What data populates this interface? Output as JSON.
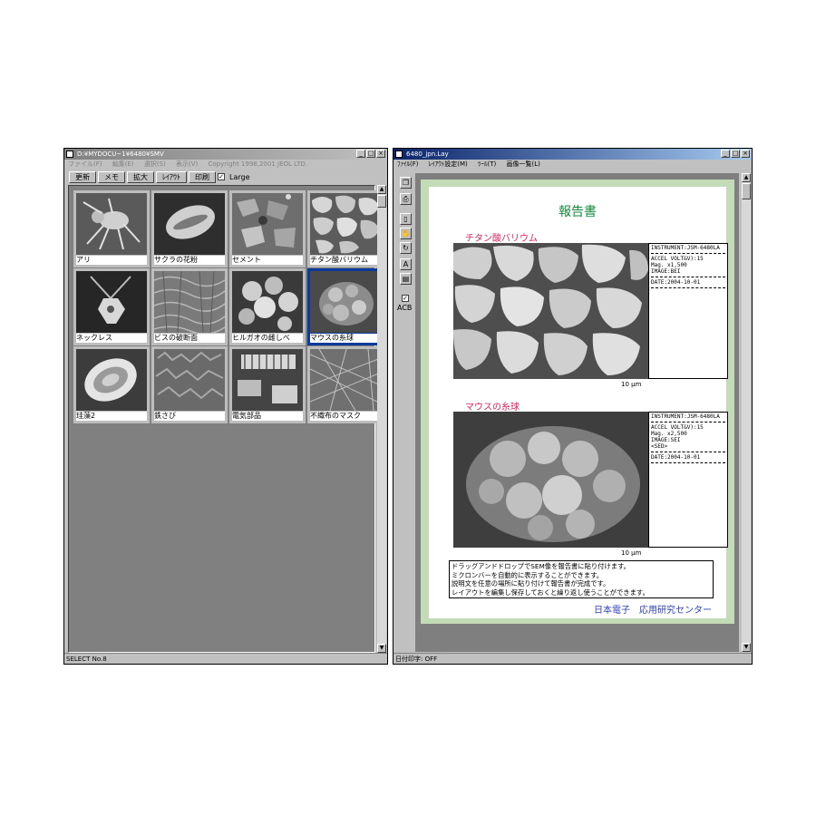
{
  "left_window": {
    "title": "D:¥MYDOCU~1¥6480¥SMV",
    "menu": [
      "ファイル(F)",
      "編集(E)",
      "選択(S)",
      "表示(V)",
      "Copyright 1998,2001 JEOL LTD."
    ],
    "toolbar": {
      "update": "更新",
      "memo": "メモ",
      "zoom": "拡大",
      "layout": "ﾚｲｱｳﾄ",
      "print": "印刷",
      "large_label": "Large",
      "large_checked": true
    },
    "thumbnails": [
      {
        "label": "アリ",
        "selected": false
      },
      {
        "label": "サクラの花粉",
        "selected": false
      },
      {
        "label": "セメント",
        "selected": false
      },
      {
        "label": "チタン酸バリウム",
        "selected": false
      },
      {
        "label": "ネックレス",
        "selected": false
      },
      {
        "label": "ビスの破断面",
        "selected": false
      },
      {
        "label": "ヒルガオの雌しべ",
        "selected": false
      },
      {
        "label": "マウスの糸球",
        "selected": true
      },
      {
        "label": "珪藻2",
        "selected": false
      },
      {
        "label": "鉄さび",
        "selected": false
      },
      {
        "label": "電気部品",
        "selected": false
      },
      {
        "label": "不織布のマスク",
        "selected": false
      }
    ],
    "status": "SELECT No.8"
  },
  "right_window": {
    "title": "6480_jpn.Lay",
    "menu": [
      "ﾌｧｲﾙ(F)",
      "ﾚｲｱｳﾄ設定(M)",
      "ﾂｰﾙ(T)",
      "画像一覧(L)"
    ],
    "tools": {
      "acb_label": "ACB",
      "text_tool": "A"
    },
    "status": "日付印字: OFF",
    "report": {
      "title": "報告書",
      "sections": [
        {
          "name": "チタン酸バリウム",
          "scale": "10 μm",
          "info": {
            "instrument": "INSTRUMENT:JSM-6480LA",
            "accel": "ACCEL VOLT&V):15",
            "mag": "Mag. x1,500",
            "image": "IMAGE:BEI",
            "date": "DATE:2004-10-01"
          }
        },
        {
          "name": "マウスの糸球",
          "scale": "10 μm",
          "info": {
            "instrument": "INSTRUMENT:JSM-6480LA",
            "accel": "ACCEL VOLT&V):15",
            "mag": "Mag. x2,500",
            "image": "IMAGE:SEI",
            "extra": "<SED>",
            "date": "DATE:2004-10-01"
          }
        }
      ],
      "notes": [
        "ドラッグアンドドロップでSEM像を報告書に貼り付けます。",
        "ミクロンバーを自動的に表示することができます。",
        "説明文を任意の場所に貼り付けて報告書が完成です。",
        "レイアウトを編集し保存しておくと繰り返し使うことができます。"
      ],
      "footer": "日本電子　応用研究センター"
    }
  }
}
